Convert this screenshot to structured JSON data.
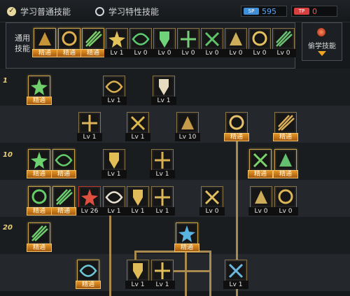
{
  "tabs": [
    {
      "label": "学习普通技能",
      "selected": true,
      "icon": "check-icon"
    },
    {
      "label": "学习特性技能",
      "selected": false,
      "icon": "radio-ring-icon"
    }
  ],
  "points": [
    {
      "badge": "SP",
      "value": "595",
      "color": "#3f8fd8",
      "icon": "skill-point-icon"
    },
    {
      "badge": "TP",
      "value": "0",
      "color": "#d84040",
      "icon": "trait-point-icon"
    }
  ],
  "common_skills": {
    "label_line1": "通用",
    "label_line2": "技能",
    "items": [
      {
        "caption": "精通",
        "mastered": true,
        "icon": "fighter-stance-icon",
        "color": "#d8a33c"
      },
      {
        "caption": "精通",
        "mastered": true,
        "icon": "fighter-kick-icon",
        "color": "#e0b050"
      },
      {
        "caption": "精通",
        "mastered": true,
        "icon": "runner-dash-icon",
        "color": "#7ad06a"
      },
      {
        "caption": "Lv 1",
        "mastered": false,
        "icon": "winged-emblem-icon",
        "color": "#e2c25a"
      },
      {
        "caption": "Lv 0",
        "mastered": false,
        "icon": "green-crosshair-icon",
        "color": "#5cc870"
      },
      {
        "caption": "Lv 0",
        "mastered": false,
        "icon": "green-diamond-icon",
        "color": "#6fd37a"
      },
      {
        "caption": "Lv 0",
        "mastered": false,
        "icon": "green-figure-icon",
        "color": "#74cf78"
      },
      {
        "caption": "Lv 0",
        "mastered": false,
        "icon": "green-runner-icon",
        "color": "#60c56a"
      },
      {
        "caption": "Lv 0",
        "mastered": false,
        "icon": "golden-seal-icon",
        "color": "#e2c060"
      },
      {
        "caption": "Lv 0",
        "mastered": false,
        "icon": "golden-warrior-icon",
        "color": "#e3c160"
      },
      {
        "caption": "Lv 0",
        "mastered": false,
        "icon": "green-banner-icon",
        "color": "#6bc374"
      }
    ]
  },
  "steal_skill": {
    "label": "偷学技能",
    "icon": "steal-orb-icon",
    "arrow": "dropdown-arrow-icon"
  },
  "level_labels": [
    "1",
    "10",
    "20"
  ],
  "tree_skills": [
    {
      "caption": "精通",
      "mastered": true,
      "icon": "green-vine-strike-icon",
      "color": "#6fcf6a"
    },
    {
      "caption": "Lv 1",
      "mastered": false,
      "icon": "golden-claw-icon",
      "color": "#d9b050"
    },
    {
      "caption": "Lv 1",
      "mastered": false,
      "icon": "white-slash-icon",
      "color": "#e8dcc0"
    },
    {
      "caption": "Lv 1",
      "mastered": false,
      "icon": "golden-crest-icon",
      "color": "#dcb358"
    },
    {
      "caption": "Lv 1",
      "mastered": false,
      "icon": "golden-arrow-icon",
      "color": "#e0b850"
    },
    {
      "caption": "Lv 10",
      "mastered": false,
      "icon": "golden-vortex-icon",
      "color": "#d8aa50"
    },
    {
      "caption": "精通",
      "mastered": false,
      "icon": "golden-shield-icon",
      "color": "#e6c36a"
    },
    {
      "caption": "精通",
      "mastered": false,
      "icon": "golden-spikes-icon",
      "color": "#dcb058"
    },
    {
      "caption": "精通",
      "mastered": true,
      "icon": "green-blade-icon",
      "color": "#6cd070"
    },
    {
      "caption": "精通",
      "mastered": true,
      "icon": "green-sword-icon",
      "color": "#62c86a"
    },
    {
      "caption": "Lv 1",
      "mastered": false,
      "icon": "golden-burst-icon",
      "color": "#e2bd55"
    },
    {
      "caption": "Lv 1",
      "mastered": false,
      "icon": "golden-whirl-icon",
      "color": "#d9b050"
    },
    {
      "caption": "精通",
      "mastered": true,
      "icon": "green-slash-icon",
      "color": "#7ad46a"
    },
    {
      "caption": "精通",
      "mastered": true,
      "icon": "green-hook-icon",
      "color": "#6bd07a"
    },
    {
      "caption": "精通",
      "mastered": true,
      "icon": "green-cut-icon",
      "color": "#66cc6a"
    },
    {
      "caption": "精通",
      "mastered": true,
      "icon": "green-star-icon",
      "color": "#6cd070"
    },
    {
      "caption": "Lv 26",
      "mastered": false,
      "icon": "red-cross-slash-icon",
      "color": "#e05040"
    },
    {
      "caption": "Lv 1",
      "mastered": false,
      "icon": "white-crescent-slash-icon",
      "color": "#e8e0d0"
    },
    {
      "caption": "Lv 1",
      "mastered": false,
      "icon": "golden-leaper-icon",
      "color": "#e2bc58"
    },
    {
      "caption": "Lv 1",
      "mastered": false,
      "icon": "golden-roll-icon",
      "color": "#dcb658"
    },
    {
      "caption": "Lv 0",
      "mastered": false,
      "icon": "golden-cross-icon",
      "color": "#e2c060"
    },
    {
      "caption": "Lv 0",
      "mastered": false,
      "icon": "golden-moon-icon",
      "color": "#e0bc60"
    },
    {
      "caption": "Lv 0",
      "mastered": false,
      "icon": "golden-drop-icon",
      "color": "#ddb658"
    },
    {
      "caption": "精通",
      "mastered": true,
      "icon": "green-branch-icon",
      "color": "#70cf6e"
    },
    {
      "caption": "精通",
      "mastered": true,
      "icon": "blue-crystal-icon",
      "color": "#5ab4e0"
    },
    {
      "caption": "精通",
      "mastered": true,
      "icon": "cyan-warrior-icon",
      "color": "#6cc8d8"
    },
    {
      "caption": "Lv 1",
      "mastered": false,
      "icon": "golden-wing-icon",
      "color": "#e0bc58"
    },
    {
      "caption": "Lv 1",
      "mastered": false,
      "icon": "golden-crescent-icon",
      "color": "#e1bd5a"
    },
    {
      "caption": "Lv 1",
      "mastered": false,
      "icon": "blue-sword-icon",
      "color": "#6ab8e0"
    }
  ]
}
